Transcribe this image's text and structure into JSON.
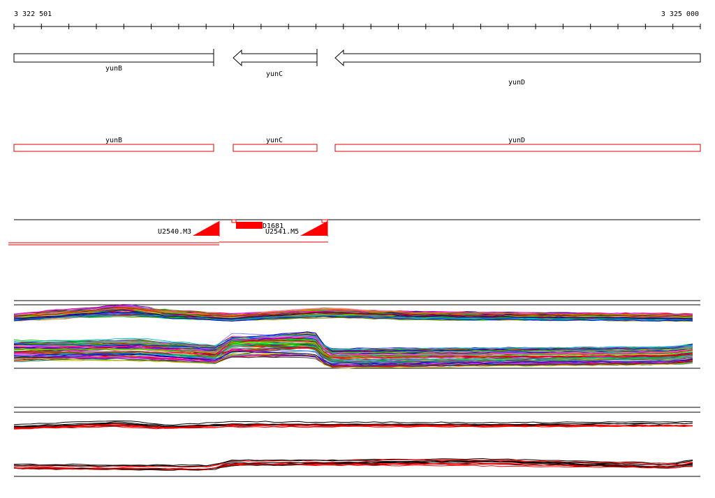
{
  "coordinate_axis": {
    "start_label": "3 322 501",
    "end_label": "3 325 000",
    "start": 3322501,
    "end": 3325000
  },
  "genes": [
    {
      "name": "yunB",
      "strand": "+",
      "start": 3322501,
      "end": 3323228
    },
    {
      "name": "yunC",
      "strand": "-",
      "start": 3323300,
      "end": 3323676
    },
    {
      "name": "yunD",
      "strand": "-",
      "start": 3323740,
      "end": 3325000
    }
  ],
  "annotations": [
    {
      "name": "yunB"
    },
    {
      "name": "yunC"
    },
    {
      "name": "yunD"
    }
  ],
  "promoters": [
    {
      "label": "U2540.M3"
    },
    {
      "label": "U2541.M5"
    }
  ],
  "terminator_label": "D1681",
  "colors": {
    "axis": "#000000",
    "gene_outline": "#000000",
    "annotation_outline": "#e00000",
    "feature_red": "#ff0000"
  }
}
